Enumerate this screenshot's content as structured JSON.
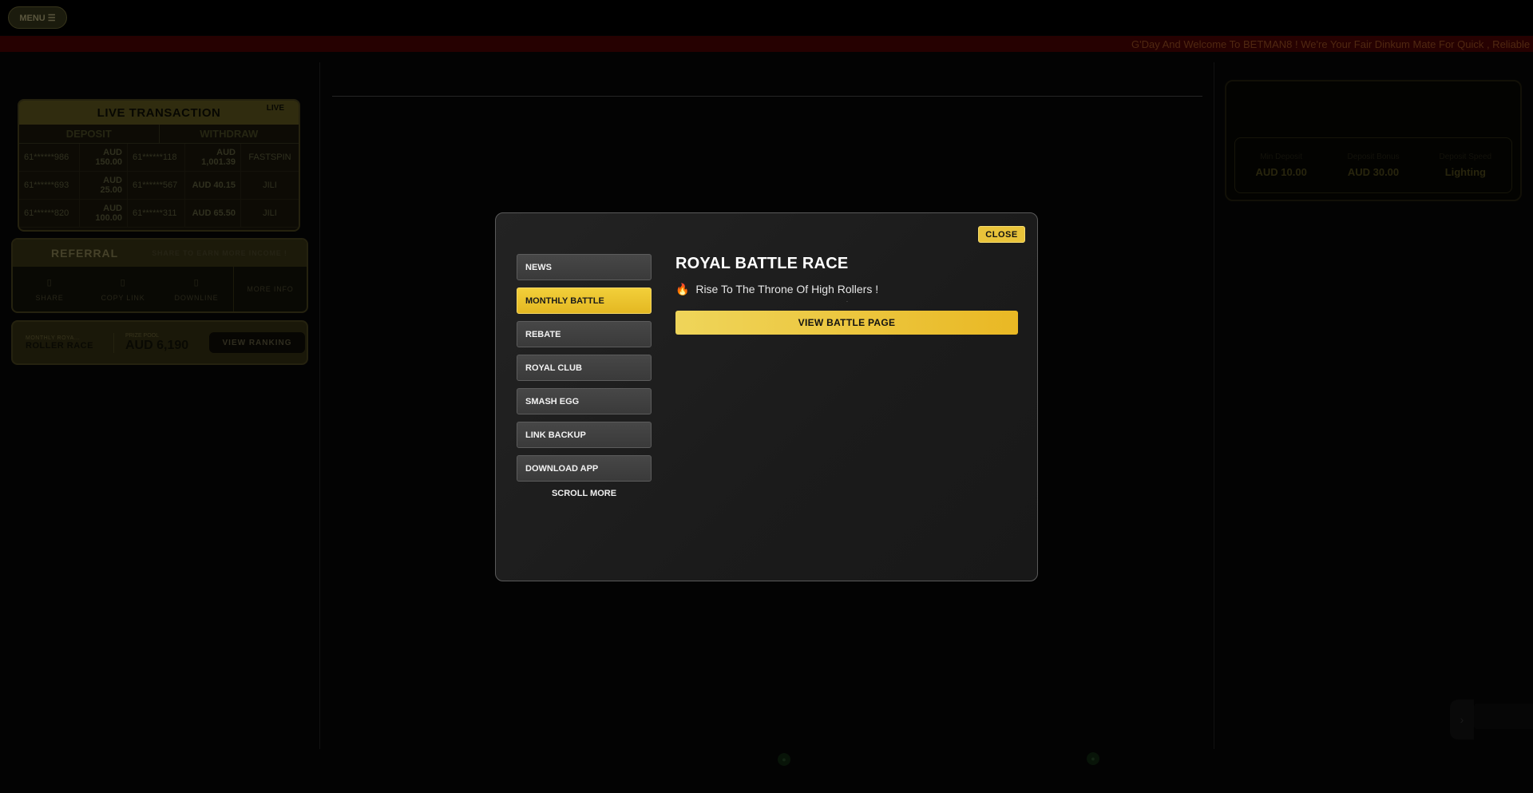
{
  "header": {
    "menu_label": "MENU ☰"
  },
  "marquee": {
    "text": "G'Day And Welcome To BETMAN8 ! We're Your Fair Dinkum Mate For Quick , Reliable"
  },
  "live_transaction": {
    "title": "LIVE TRANSACTION",
    "live_badge": "LIVE",
    "deposit_label": "DEPOSIT",
    "withdraw_label": "WITHDRAW",
    "rows": [
      {
        "dep_user": "61******986",
        "dep_amount": "AUD 150.00",
        "wd_user": "61******118",
        "wd_amount": "AUD 1,001.39",
        "provider": "FASTSPIN"
      },
      {
        "dep_user": "61******693",
        "dep_amount": "AUD 25.00",
        "wd_user": "61******567",
        "wd_amount": "AUD 40.15",
        "provider": "JILI"
      },
      {
        "dep_user": "61******820",
        "dep_amount": "AUD 100.00",
        "wd_user": "61******311",
        "wd_amount": "AUD 65.50",
        "provider": "JILI"
      }
    ]
  },
  "referral": {
    "title": "REFERRAL",
    "subtitle": "SHARE TO EARN MORE INCOME !",
    "items": [
      "SHARE",
      "COPY LINK",
      "DOWNLINE"
    ],
    "more_info": "MORE INFO"
  },
  "race_bar": {
    "small_label": "MONTHLY ROYA...",
    "name": "ROLLER RACE",
    "prize_label": "PRIZE POOL",
    "prize": "AUD 6,190",
    "button": "VIEW RANKING"
  },
  "right_panel": {
    "cols": [
      {
        "label": "Min Deposit",
        "value": "AUD 10.00"
      },
      {
        "label": "Deposit Bonus",
        "value": "AUD 30.00"
      },
      {
        "label": "Deposit Speed",
        "value": "Lighting"
      }
    ]
  },
  "modal": {
    "close_label": "CLOSE",
    "tabs": [
      {
        "label": "NEWS",
        "icon": ""
      },
      {
        "label": "MONTHLY BATTLE",
        "icon": ""
      },
      {
        "label": "REBATE",
        "icon": ""
      },
      {
        "label": "ROYAL CLUB",
        "icon": ""
      },
      {
        "label": "SMASH EGG",
        "icon": ""
      },
      {
        "label": "LINK BACKUP",
        "icon": ""
      },
      {
        "label": "DOWNLOAD APP",
        "icon": ""
      }
    ],
    "tab_arrow": "",
    "scroll_more": "SCROLL MORE",
    "content": {
      "title_icon": "",
      "title": "ROYAL BATTLE RACE",
      "subtitle_emoji": "🔥",
      "subtitle": "Rise To The Throne Of High Rollers !",
      "button": "VIEW BATTLE PAGE"
    }
  },
  "colors": {
    "accent": "#e9c33a",
    "marquee_bg": "#3b0303",
    "modal_bg": "#1e1e1e"
  }
}
